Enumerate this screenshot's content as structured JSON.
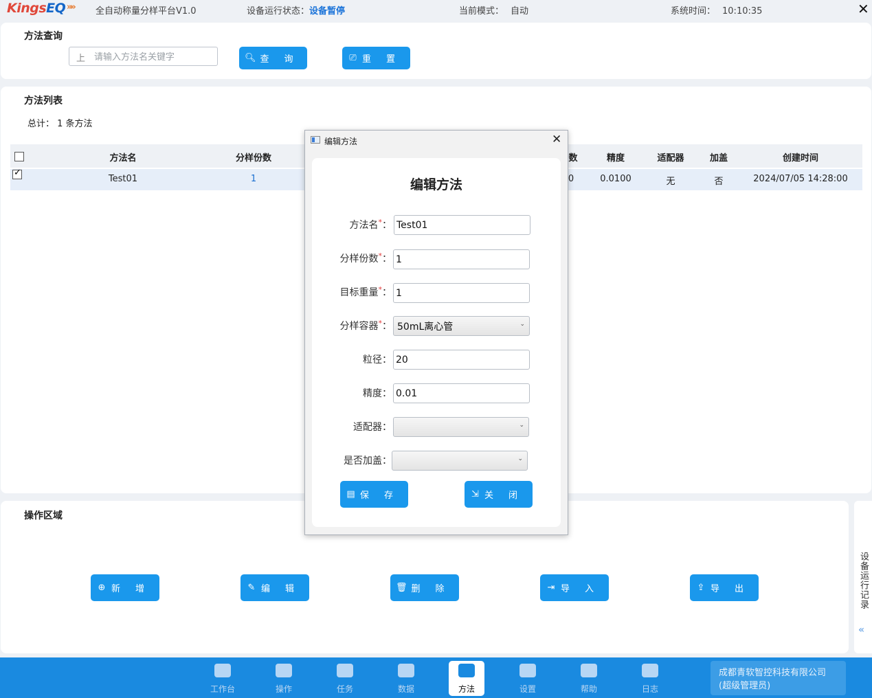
{
  "topbar": {
    "logo_kings": "Kings",
    "logo_eq": "EQ",
    "logo_arrows": "»»",
    "platform": "全自动称量分样平台V1.0",
    "status_label": "设备运行状态：",
    "status_value": "设备暂停",
    "mode_label": "当前模式：",
    "mode_value": "自动",
    "time_label": "系统时间：",
    "time_value": "10:10:35",
    "close": "✕"
  },
  "query": {
    "title": "方法查询",
    "search_placeholder": "请输入方法名关键字",
    "search_icon": "上",
    "query_button": "查询",
    "reset_button": "重置"
  },
  "list": {
    "title": "方法列表",
    "total": "总计： 1 条方法",
    "columns": {
      "name": "方法名",
      "portions": "分样份数",
      "partial": "数",
      "precision": "精度",
      "adapter": "适配器",
      "cap": "加盖",
      "created": "创建时间"
    },
    "rows": [
      {
        "name": "Test01",
        "portions": "1",
        "partial": "0",
        "precision": "0.0100",
        "adapter": "无",
        "cap": "否",
        "created": "2024/07/05 14:28:00"
      }
    ]
  },
  "ops": {
    "title": "操作区域",
    "add": "新增",
    "edit": "编辑",
    "delete": "删除",
    "import": "导入",
    "export": "导出"
  },
  "side_tab": {
    "label": "设备运行记录",
    "arrow": "«"
  },
  "nav": {
    "items": [
      "工作台",
      "操作",
      "任务",
      "数据",
      "方法",
      "设置",
      "帮助",
      "日志"
    ],
    "active": "方法"
  },
  "company": {
    "name": "成都青软智控科技有限公司",
    "role": "(超级管理员)"
  },
  "modal": {
    "window_title": "编辑方法",
    "close": "✕",
    "heading": "编辑方法",
    "fields": {
      "name_label": "方法名",
      "name_value": "Test01",
      "portions_label": "分样份数",
      "portions_value": "1",
      "target_label": "目标重量",
      "target_value": "1",
      "container_label": "分样容器",
      "container_value": "50mL离心管",
      "particle_label": "粒径",
      "particle_value": "20",
      "precision_label": "精度",
      "precision_value": "0.01",
      "adapter_label": "适配器",
      "adapter_value": "",
      "cap_label": "是否加盖",
      "cap_value": ""
    },
    "required_mark": "*",
    "colon": "：",
    "save": "保存",
    "close_button": "关闭"
  },
  "colors": {
    "primary": "#1a98ec",
    "nav_bar": "#1a8ae0",
    "status_value": "#1a73d9",
    "logo_red": "#e0483a",
    "logo_blue": "#1466c8"
  }
}
